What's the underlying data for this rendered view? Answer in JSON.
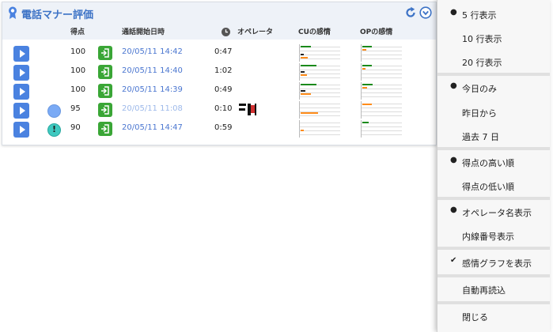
{
  "widget": {
    "title": "電話マナー評価",
    "columns": {
      "score": "得点",
      "start_time": "通話開始日時",
      "operator": "オペレータ",
      "cu_emotion": "CUの感情",
      "op_emotion": "OPの感情"
    },
    "rows": [
      {
        "score": "100",
        "datetime": "20/05/11 14:42",
        "duration": "0:47",
        "status": ""
      },
      {
        "score": "100",
        "datetime": "20/05/11 14:40",
        "duration": "1:02",
        "status": ""
      },
      {
        "score": "100",
        "datetime": "20/05/11 14:39",
        "duration": "0:49",
        "status": ""
      },
      {
        "score": "95",
        "datetime": "20/05/11 11:08",
        "duration": "0:10",
        "status": "blue-dot"
      },
      {
        "score": "90",
        "datetime": "20/05/11 14:47",
        "duration": "0:59",
        "status": "exclamation"
      }
    ]
  },
  "menu": {
    "items": [
      {
        "label": "5 行表示",
        "selected": true
      },
      {
        "label": "10 行表示",
        "selected": false
      },
      {
        "label": "20 行表示",
        "selected": false
      },
      {
        "label": "今日のみ",
        "selected": true
      },
      {
        "label": "昨日から",
        "selected": false
      },
      {
        "label": "過去 7 日",
        "selected": false
      },
      {
        "label": "得点の高い順",
        "selected": true
      },
      {
        "label": "得点の低い順",
        "selected": false
      },
      {
        "label": "オペレータ名表示",
        "selected": true
      },
      {
        "label": "内線番号表示",
        "selected": false
      },
      {
        "label": "感情グラフを表示",
        "selected": true
      },
      {
        "label": "自動再読込",
        "selected": false
      },
      {
        "label": "閉じる",
        "selected": false
      }
    ],
    "marks": {
      "dot": "●",
      "check": "✔"
    }
  },
  "colors": {
    "accent": "#3d73c6",
    "play": "#4a82e0",
    "green": "#3aa636",
    "orange": "#ff8c1a"
  }
}
